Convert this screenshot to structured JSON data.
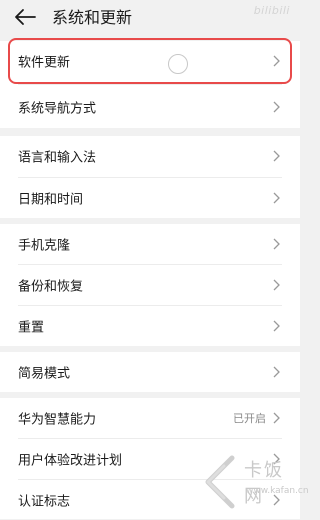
{
  "header": {
    "title": "系统和更新",
    "watermark": "bilibili"
  },
  "sections": [
    {
      "items": [
        {
          "label": "软件更新",
          "value": ""
        },
        {
          "label": "系统导航方式",
          "value": ""
        }
      ]
    },
    {
      "items": [
        {
          "label": "语言和输入法",
          "value": ""
        },
        {
          "label": "日期和时间",
          "value": ""
        }
      ]
    },
    {
      "items": [
        {
          "label": "手机克隆",
          "value": ""
        },
        {
          "label": "备份和恢复",
          "value": ""
        },
        {
          "label": "重置",
          "value": ""
        }
      ]
    },
    {
      "items": [
        {
          "label": "简易模式",
          "value": ""
        }
      ]
    },
    {
      "items": [
        {
          "label": "华为智慧能力",
          "value": "已开启"
        },
        {
          "label": "用户体验改进计划",
          "value": ""
        },
        {
          "label": "认证标志",
          "value": ""
        }
      ]
    }
  ],
  "watermark_logo": {
    "main": "卡饭网",
    "sub": "www.kafan.cn"
  },
  "colors": {
    "highlight": "#e84a4a",
    "background": "#f1f1f1"
  },
  "icons": [
    "back-arrow-icon",
    "chevron-right-icon",
    "touch-indicator-icon"
  ]
}
